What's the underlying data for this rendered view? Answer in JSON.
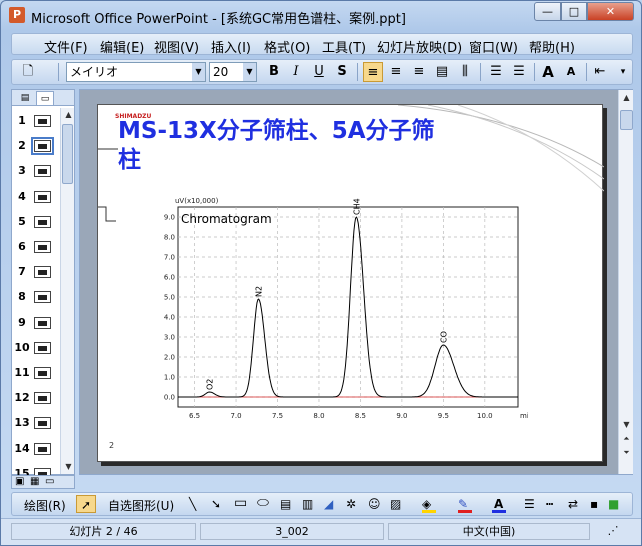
{
  "window": {
    "title": "Microsoft Office PowerPoint - [系统GC常用色谱柱、案例.ppt]",
    "app_icon": "P",
    "buttons": {
      "minimize": "—",
      "maximize": "□",
      "close": "✕"
    }
  },
  "menu": [
    "文件(F)",
    "编辑(E)",
    "视图(V)",
    "插入(I)",
    "格式(O)",
    "工具(T)",
    "幻灯片放映(D)",
    "窗口(W)",
    "帮助(H)"
  ],
  "toolbar": {
    "font_name": "メイリオ",
    "font_size": "20",
    "bold": "B",
    "italic": "I",
    "underline": "U",
    "shadow": "S",
    "grow_font": "A",
    "shrink_font": "A"
  },
  "outline": {
    "slide_numbers": [
      "1",
      "2",
      "3",
      "4",
      "5",
      "6",
      "7",
      "8",
      "9",
      "10",
      "11",
      "12",
      "13",
      "14",
      "15"
    ],
    "selected": "2"
  },
  "slide": {
    "title": "MS-13X分子筛柱、5A分子筛柱",
    "brand": "SHIMADZU",
    "page_number": "2"
  },
  "chart_data": {
    "type": "line",
    "title": "Chromatogram",
    "ylabel": "uV(x10,000)",
    "xlabel": "min",
    "xlim": [
      6.3,
      10.4
    ],
    "ylim": [
      -0.5,
      9.5
    ],
    "x_ticks": [
      "6.5",
      "7.0",
      "7.5",
      "8.0",
      "8.5",
      "9.0",
      "9.5",
      "10.0"
    ],
    "y_ticks": [
      "0.0",
      "1.0",
      "2.0",
      "3.0",
      "4.0",
      "5.0",
      "6.0",
      "7.0",
      "8.0",
      "9.0"
    ],
    "grid": true,
    "peaks": [
      {
        "label": "O2",
        "x": 6.68,
        "height": 0.25
      },
      {
        "label": "N2",
        "x": 7.27,
        "height": 4.9
      },
      {
        "label": "CH4",
        "x": 8.45,
        "height": 9.0
      },
      {
        "label": "CO",
        "x": 9.5,
        "height": 2.6
      }
    ]
  },
  "drawing": {
    "draw_menu": "绘图(R)",
    "autoshapes": "自选图形(U)",
    "font_color_letter": "A"
  },
  "status": {
    "slide": "幻灯片 2 / 46",
    "design": "3_002",
    "language": "中文(中国)"
  }
}
